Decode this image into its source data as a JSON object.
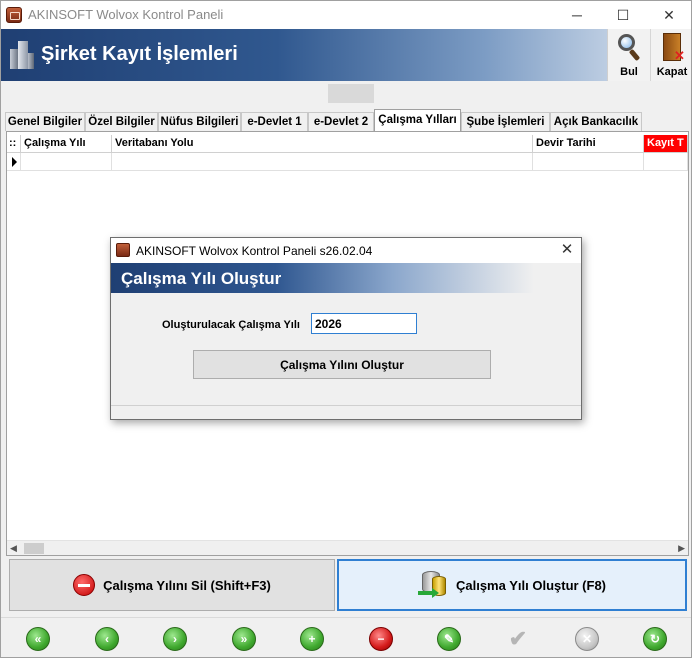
{
  "window": {
    "title": "AKINSOFT Wolvox Kontrol Paneli",
    "controls": {
      "minimize": "─",
      "maximize": "☐",
      "close": "✕"
    }
  },
  "header": {
    "title": "Şirket Kayıt İşlemleri",
    "tools": [
      {
        "label": "Bul",
        "icon": "magnifier-icon"
      },
      {
        "label": "Kapat",
        "icon": "exit-door-icon"
      }
    ]
  },
  "tabs": [
    {
      "label": "Genel Bilgiler",
      "active": false
    },
    {
      "label": "Özel Bilgiler",
      "active": false
    },
    {
      "label": "Nüfus Bilgileri",
      "active": false
    },
    {
      "label": "e-Devlet 1",
      "active": false
    },
    {
      "label": "e-Devlet 2",
      "active": false
    },
    {
      "label": "Çalışma Yılları",
      "active": true
    },
    {
      "label": "Şube İşlemleri",
      "active": false
    },
    {
      "label": "Açık Bankacılık",
      "active": false
    }
  ],
  "grid": {
    "corner": "::",
    "columns": [
      "Çalışma Yılı",
      "Veritabanı Yolu",
      "Devir Tarihi",
      "Kayıt T"
    ],
    "rows": [
      [
        "",
        "",
        "",
        ""
      ]
    ]
  },
  "actions": {
    "delete_label": "Çalışma Yılını Sil (Shift+F3)",
    "create_label": "Çalışma Yılı Oluştur (F8)"
  },
  "navbar": [
    {
      "name": "nav-first",
      "icon": "double-left-arrow-icon",
      "glyph": "«",
      "color": "green"
    },
    {
      "name": "nav-prev",
      "icon": "left-arrow-icon",
      "glyph": "‹",
      "color": "green"
    },
    {
      "name": "nav-next",
      "icon": "right-arrow-icon",
      "glyph": "›",
      "color": "green"
    },
    {
      "name": "nav-last",
      "icon": "double-right-arrow-icon",
      "glyph": "»",
      "color": "green"
    },
    {
      "name": "nav-add",
      "icon": "plus-icon",
      "glyph": "+",
      "color": "green"
    },
    {
      "name": "nav-delete",
      "icon": "minus-icon",
      "glyph": "−",
      "color": "red"
    },
    {
      "name": "nav-edit",
      "icon": "edit-pencil-icon",
      "glyph": "✎",
      "color": "green"
    },
    {
      "name": "nav-confirm",
      "icon": "checkmark-icon",
      "glyph": "✔",
      "color": "plain"
    },
    {
      "name": "nav-cancel",
      "icon": "cancel-x-icon",
      "glyph": "✕",
      "color": "gray"
    },
    {
      "name": "nav-refresh",
      "icon": "refresh-icon",
      "glyph": "↻",
      "color": "green"
    }
  ],
  "dialog": {
    "title": "AKINSOFT Wolvox Kontrol Paneli s26.02.04",
    "close": "✕",
    "banner": "Çalışma Yılı Oluştur",
    "field_label": "Oluşturulacak Çalışma Yılı",
    "field_value": "2026",
    "button_label": "Çalışma Yılını Oluştur"
  }
}
